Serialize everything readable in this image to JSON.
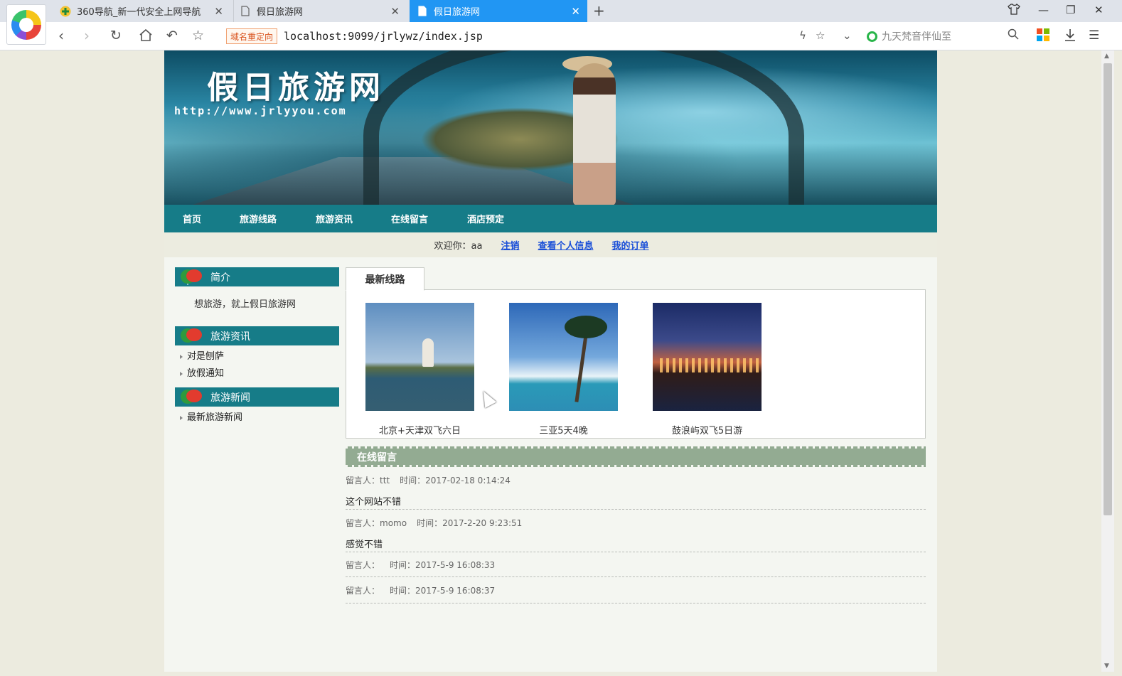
{
  "browser": {
    "tabs": [
      {
        "title": "360导航_新一代安全上网导航",
        "active": false
      },
      {
        "title": "假日旅游网",
        "active": false
      },
      {
        "title": "假日旅游网",
        "active": true
      }
    ],
    "new_tab_label": "+",
    "url": "localhost:9099/jrlywz/index.jsp",
    "redirect_badge": "域名重定向",
    "search_placeholder": "九天梵音伴仙至"
  },
  "site": {
    "title": "假日旅游网",
    "url": "http://www.jrlyyou.com"
  },
  "nav": {
    "items": [
      "首页",
      "旅游线路",
      "旅游资讯",
      "在线留言",
      "酒店预定"
    ]
  },
  "welcome": {
    "text": "欢迎你：aa",
    "links": [
      "注销",
      "查看个人信息",
      "我的订单"
    ]
  },
  "sidebar": {
    "intro": {
      "title": "简介",
      "text": "想旅游，就上假日旅游网"
    },
    "info": {
      "title": "旅游资讯",
      "items": [
        "对是刨萨",
        "放假通知"
      ]
    },
    "news": {
      "title": "旅游新闻",
      "items": [
        "最新旅游新闻"
      ]
    }
  },
  "routes": {
    "tab_label": "最新线路",
    "items": [
      {
        "caption": "北京+天津双飞六日"
      },
      {
        "caption": "三亚5天4晚"
      },
      {
        "caption": "鼓浪屿双飞5日游"
      }
    ]
  },
  "messages": {
    "title": "在线留言",
    "items": [
      {
        "author": "留言人：ttt",
        "time": "时间：2017-02-18 0:14:24",
        "body": "这个网站不错"
      },
      {
        "author": "留言人：momo",
        "time": "时间：2017-2-20 9:23:51",
        "body": "感觉不错"
      },
      {
        "author": "留言人：",
        "time": "时间：2017-5-9 16:08:33",
        "body": ""
      },
      {
        "author": "留言人：",
        "time": "时间：2017-5-9 16:08:37",
        "body": ""
      }
    ]
  },
  "colors": {
    "teal": "#167c88",
    "sage": "#93ab92",
    "tab_active": "#2196f3",
    "link": "#1a4fd8"
  }
}
